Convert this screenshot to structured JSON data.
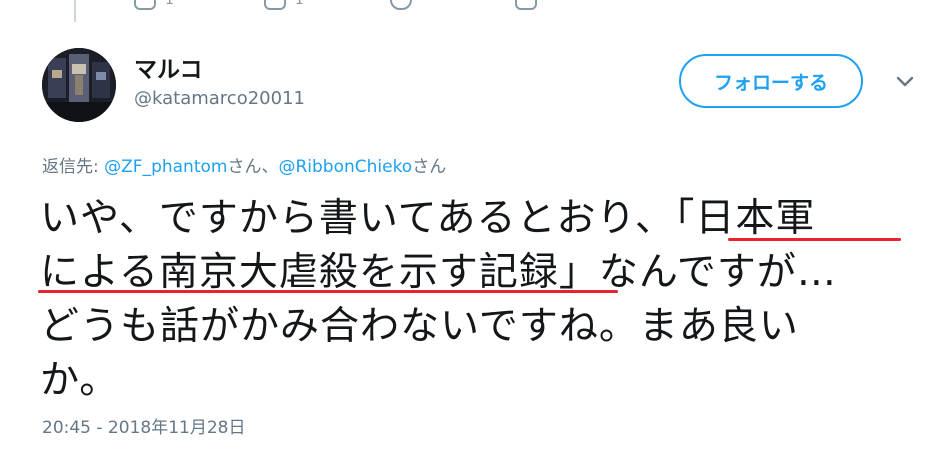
{
  "colors": {
    "accent": "#1da1f2",
    "secondary_text": "#657786",
    "primary_text": "#14171a",
    "annotation_red": "#e8232b"
  },
  "icons": [
    "reply-icon",
    "retweet-icon",
    "like-icon",
    "share-icon",
    "chevron-down-icon"
  ],
  "user": {
    "name": "マルコ",
    "handle": "@katamarco20011"
  },
  "follow_label": "フォローする",
  "reply_to": {
    "prefix": "返信先: ",
    "mention1": "@ZF_phantom",
    "mid": "さん、",
    "mention2": "@RibbonChieko",
    "suffix": "さん"
  },
  "tweet": {
    "line1": "いや、ですから書いてあるとおり、「日本軍",
    "line2": "による南京大虐殺を示す記録」なんですが…",
    "line3": "どうも話がかみ合わないですね。まあ良い",
    "line4": "か。"
  },
  "timestamp": "20:45 - 2018年11月28日"
}
